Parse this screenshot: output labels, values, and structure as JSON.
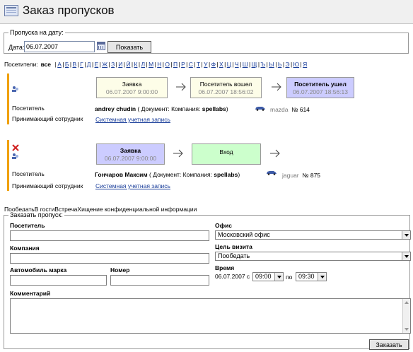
{
  "header": {
    "title": "Заказ пропусков"
  },
  "date_filter": {
    "legend": "Пропуска на дату:",
    "label": "Дата:",
    "value": "06.07.2007",
    "button": "Показать"
  },
  "visitor_filter": {
    "label": "Посетители:",
    "all": "все",
    "letters": [
      "А",
      "Б",
      "В",
      "Г",
      "Д",
      "Е",
      "Ж",
      "З",
      "И",
      "Й",
      "К",
      "Л",
      "М",
      "Н",
      "О",
      "П",
      "Р",
      "С",
      "Т",
      "У",
      "Ф",
      "Х",
      "Ц",
      "Ч",
      "Ш",
      "Щ",
      "Ъ",
      "Ы",
      "Ь",
      "Э",
      "Ю",
      "Я"
    ]
  },
  "visits": [
    {
      "stages": [
        {
          "title": "Заявка",
          "time": "06.07.2007 9:00:00",
          "color": "#fdfde8"
        },
        {
          "title": "Посетитель вошел",
          "time": "06.07.2007 18:56:02",
          "color": "#fdfde8"
        },
        {
          "title": "Посетитель ушел",
          "time": "06.07.2007 18:56:13",
          "color": "#ccccff"
        }
      ],
      "visitor_label": "Посетитель",
      "visitor_name": "andrey chudin",
      "document_prefix": "( Документ: Компания:",
      "company": "spellabs",
      "document_suffix": ")",
      "car_model": "mazda",
      "car_number": "№ 614",
      "employee_label": "Принимающий сотрудник",
      "employee": "Системная учетная запись"
    },
    {
      "stages": [
        {
          "title": "Заявка",
          "time": "06.07.2007 9:00:00",
          "color": "#ccccff"
        },
        {
          "title": "Вход",
          "color": "#ccffcc"
        }
      ],
      "visitor_label": "Посетитель",
      "visitor_name": "Гончаров Максим",
      "document_prefix": "( Документ: Компания:",
      "company": "spellabs",
      "document_suffix": ")",
      "car_model": "jaguar",
      "car_number": "№ 875",
      "employee_label": "Принимающий сотрудник",
      "employee": "Системная учетная запись"
    }
  ],
  "goals_text": "ПообедатьВ гостиВстречаХищение конфиденциальной информации",
  "order_form": {
    "legend": "Заказать пропуск:",
    "visitor_label": "Посетитель",
    "company_label": "Компания",
    "car_brand_label": "Автомобиль марка",
    "car_number_label": "Номер",
    "comment_label": "Комментарий",
    "office_label": "Офис",
    "office_value": "Московский офис",
    "purpose_label": "Цель визита",
    "purpose_value": "Пообедать",
    "time_label": "Время",
    "time_date": "06.07.2007",
    "from_label": "с",
    "from_value": "09:00",
    "to_label": "по",
    "to_value": "09:30",
    "submit": "Заказать"
  },
  "colors": {
    "accent": "#f0a000",
    "link": "#1a3e9a"
  }
}
